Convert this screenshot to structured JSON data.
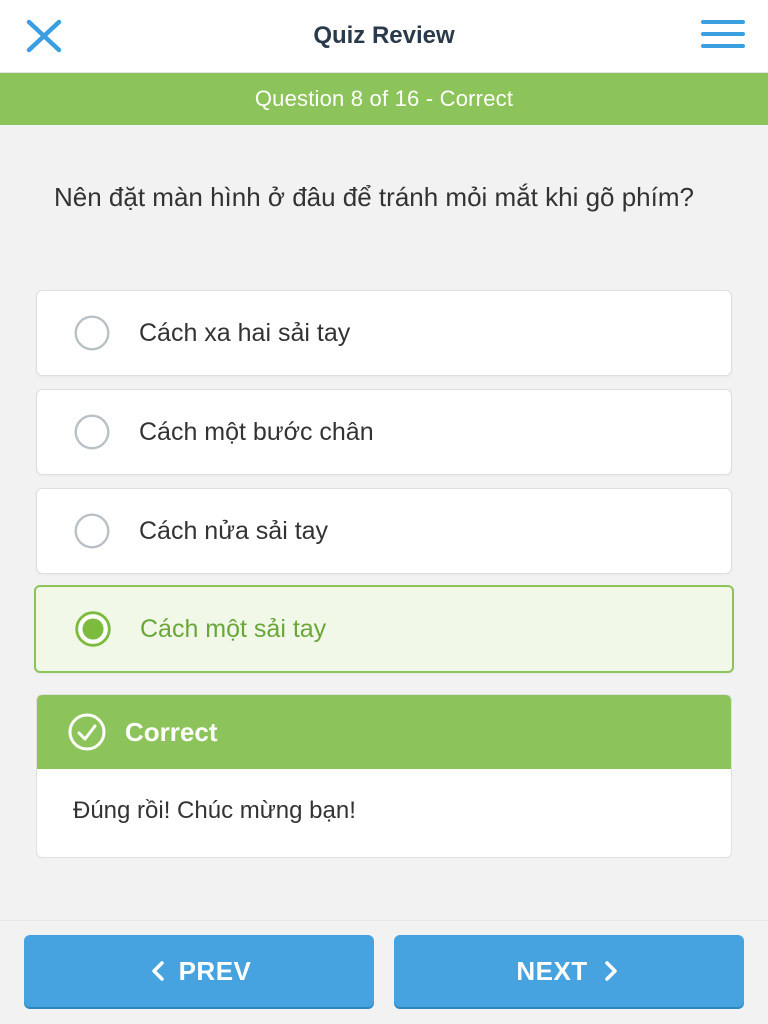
{
  "header": {
    "title": "Quiz Review",
    "close_icon": "close-icon",
    "menu_icon": "hamburger-menu-icon"
  },
  "status": {
    "text": "Question 8 of 16 - Correct",
    "color": "#8cc35a"
  },
  "question": {
    "text": "Nên đặt màn hình ở đâu để tránh mỏi mắt khi gõ phím?"
  },
  "options": [
    {
      "label": "Cách xa hai sải tay",
      "selected": false
    },
    {
      "label": "Cách một bước chân",
      "selected": false
    },
    {
      "label": "Cách nửa sải tay",
      "selected": false
    },
    {
      "label": "Cách một sải tay",
      "selected": true
    }
  ],
  "feedback": {
    "title": "Correct",
    "icon": "check-circle-icon",
    "message": "Đúng rồi! Chúc mừng bạn!"
  },
  "navigation": {
    "prev_label": "PREV",
    "next_label": "NEXT",
    "color": "#46a3e0"
  }
}
